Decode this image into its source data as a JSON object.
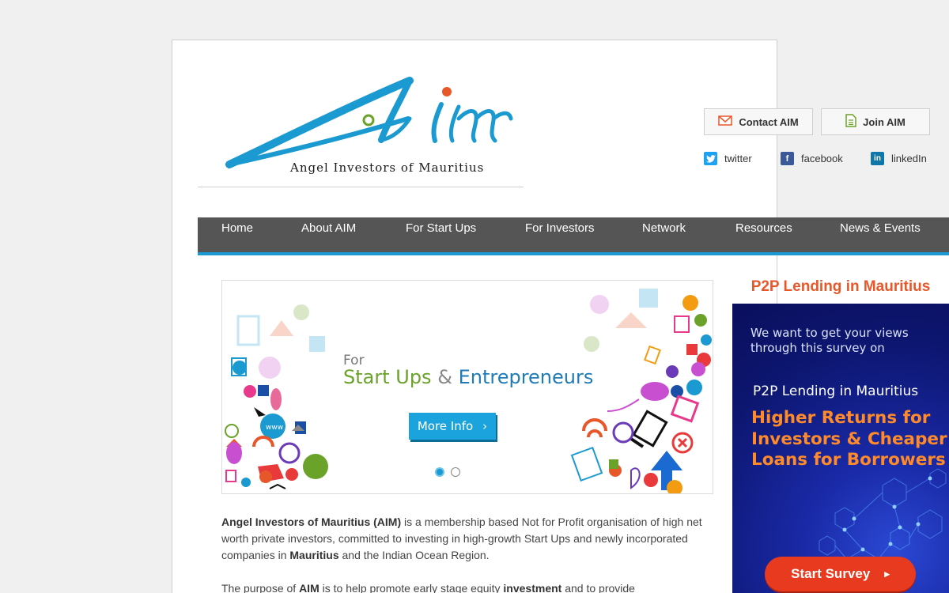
{
  "logo": {
    "tagline": "Angel Investors of Mauritius"
  },
  "header": {
    "contact_label": "Contact AIM",
    "join_label": "Join AIM",
    "social": [
      {
        "label": "twitter",
        "color": "#1da1f2",
        "icon": "twitter-icon"
      },
      {
        "label": "facebook",
        "color": "#3b5998",
        "icon": "facebook-icon"
      },
      {
        "label": "linkedIn",
        "color": "#0e76a8",
        "icon": "linkedin-icon"
      }
    ]
  },
  "nav": {
    "items": [
      {
        "label": "Home"
      },
      {
        "label": "About AIM"
      },
      {
        "label": "For Start Ups"
      },
      {
        "label": "For Investors"
      },
      {
        "label": "Network"
      },
      {
        "label": "Resources"
      },
      {
        "label": "News & Events"
      }
    ]
  },
  "slider": {
    "for": "For",
    "headline_a": "Start Ups",
    "headline_amp": "&",
    "headline_b": "Entrepreneurs",
    "button": "More Info",
    "button_chevron": "›",
    "slides": 2,
    "active_slide": 1
  },
  "content": {
    "p1_b1": "Angel Investors of Mauritius (AIM)",
    "p1_t1": " is a membership based Not for Profit organisation of high net worth private investors, committed to investing in high-growth Start Ups and newly incorporated companies in ",
    "p1_b2": "Mauritius",
    "p1_t2": " and the Indian Ocean Region.",
    "p2_t1": "The purpose of ",
    "p2_b1": "AIM",
    "p2_t2": " is to help promote early stage equity ",
    "p2_b2": "investment",
    "p2_t3": " and to provide"
  },
  "sidebar": {
    "title": "P2P Lending in Mauritius",
    "banner": {
      "intro_1": "We want to get your views",
      "intro_2": "through this survey on",
      "subtitle": "P2P Lending in Mauritius",
      "head_1": "Higher Returns for",
      "head_2": "Investors & Cheaper",
      "head_3": "Loans for Borrowers",
      "button": "Start Survey",
      "button_arrow": "▸"
    }
  },
  "colors": {
    "nav_bg": "#555555",
    "nav_accent": "#1a9ad1",
    "sidebar_title": "#e8572a",
    "survey_button": "#e83a1e",
    "banner_headline": "#ff8a2a"
  }
}
